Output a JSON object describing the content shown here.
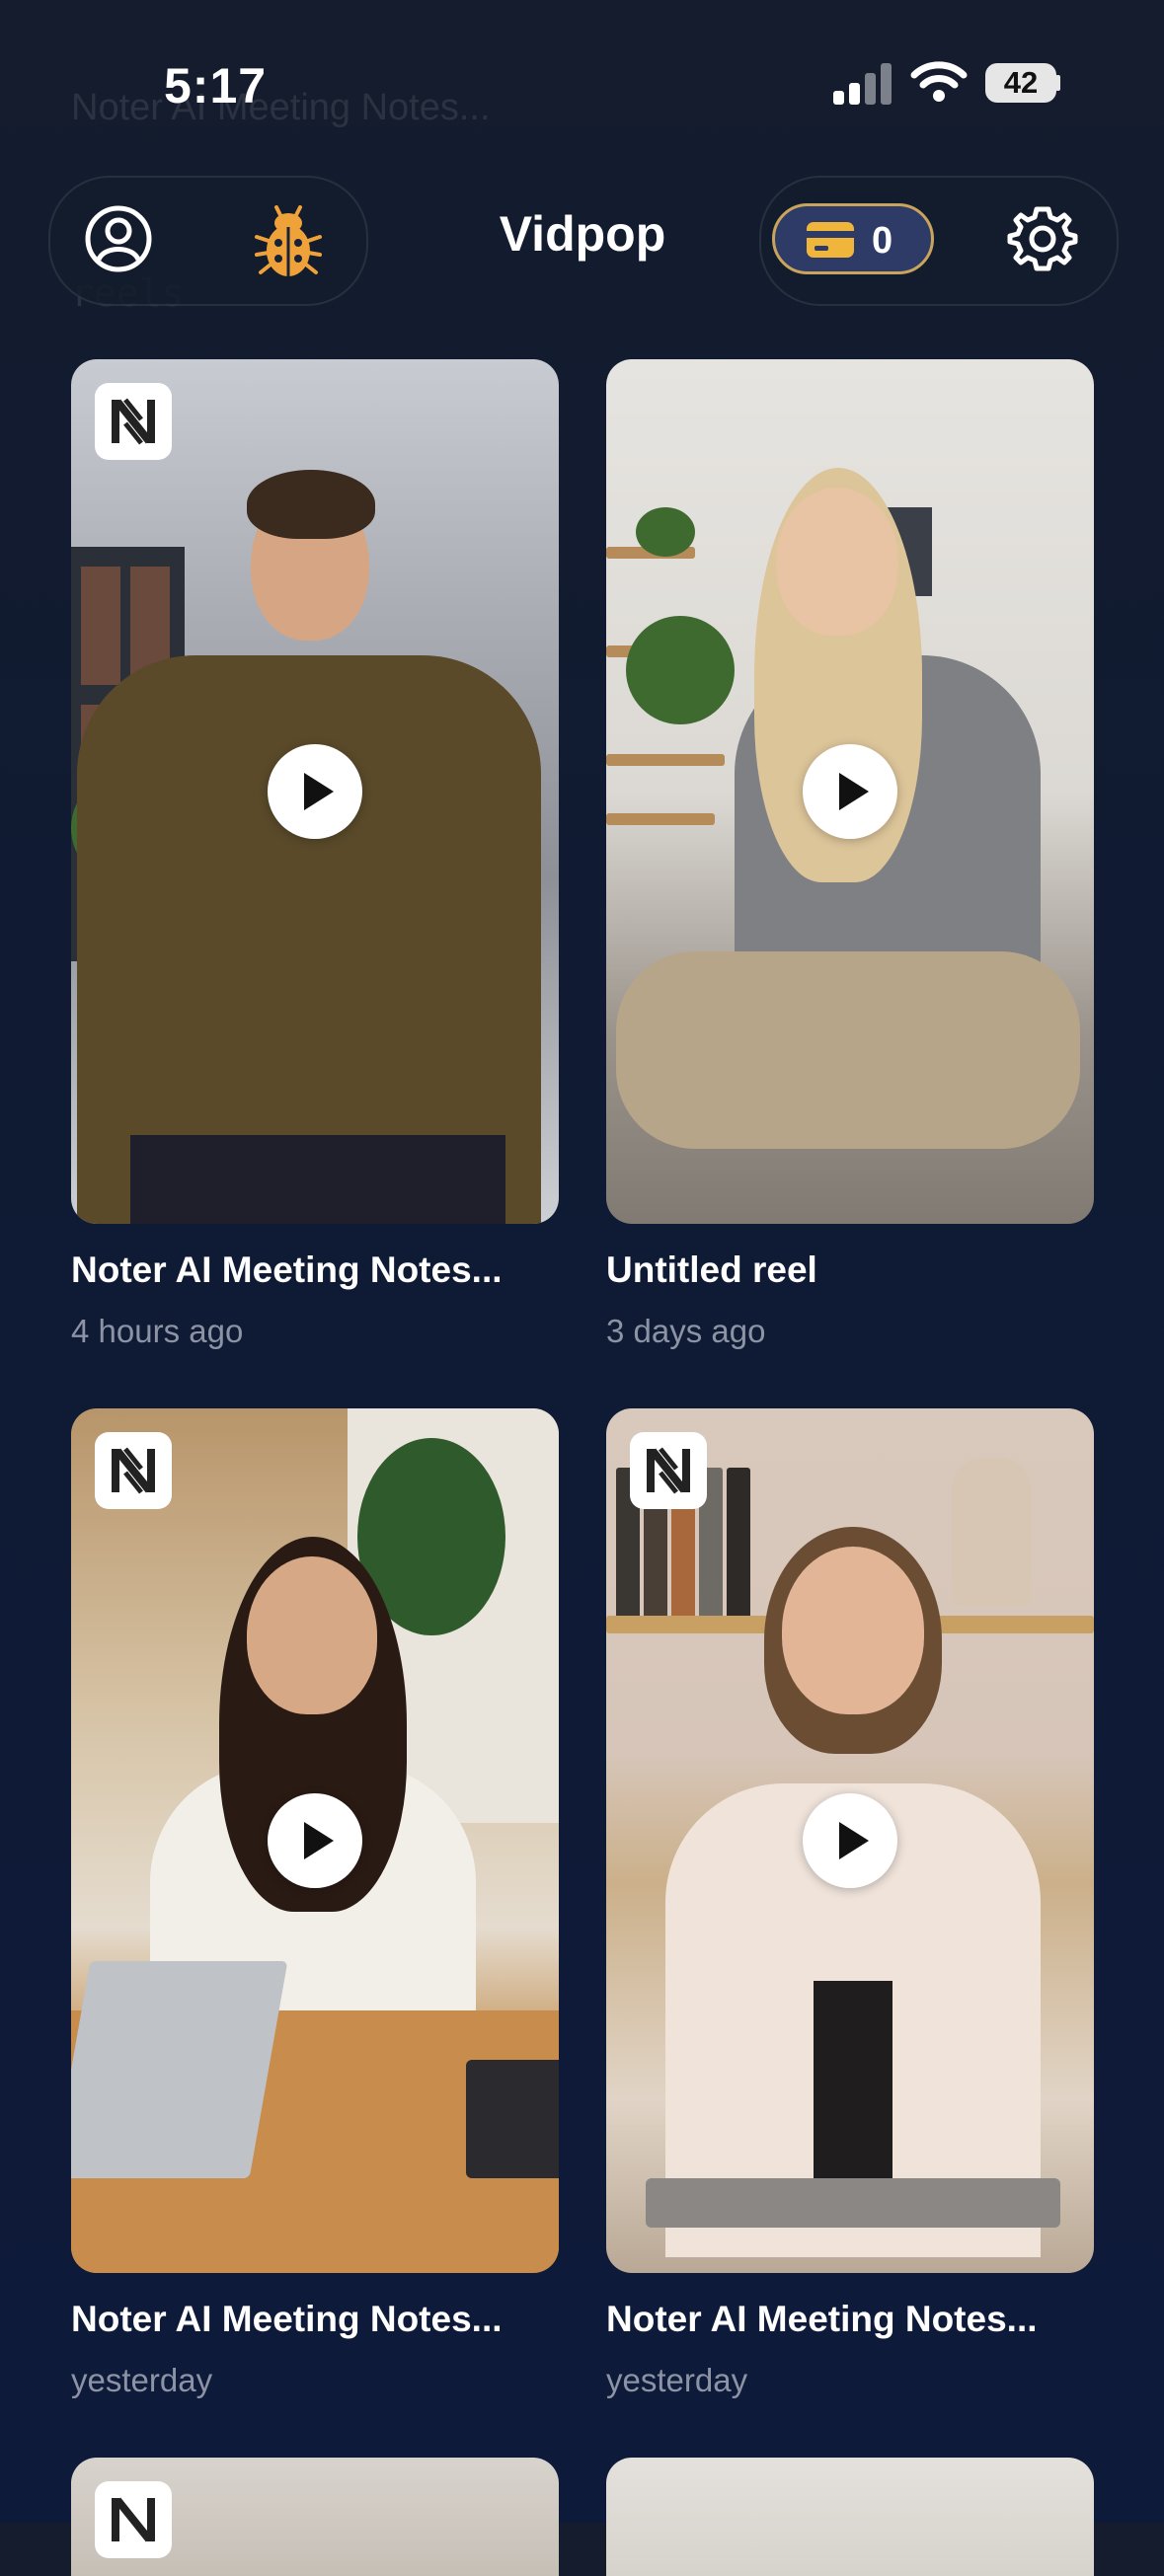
{
  "status_bar": {
    "time": "5:17",
    "battery": "42"
  },
  "background_text": {
    "line1": "Noter AI Meeting Notes...",
    "line2": "",
    "line3": "reels"
  },
  "header": {
    "app_title": "Vidpop",
    "credits": "0",
    "colors": {
      "accent_gold": "#f0b63b",
      "bug_orange": "#f0a23a",
      "pill_border": "#c9a45c"
    }
  },
  "reels": [
    {
      "title": "Noter AI Meeting Notes...",
      "time": "4 hours ago",
      "has_brand_badge": true
    },
    {
      "title": "Untitled reel",
      "time": "3 days ago",
      "has_brand_badge": false
    },
    {
      "title": "Noter AI Meeting Notes...",
      "time": "yesterday",
      "has_brand_badge": true
    },
    {
      "title": "Noter AI Meeting Notes...",
      "time": "yesterday",
      "has_brand_badge": true
    }
  ],
  "icons": {
    "profile": "profile-icon",
    "bug": "bug-icon",
    "credits": "credit-card-icon",
    "settings": "gear-icon",
    "play": "play-icon",
    "brand": "noter-logo-icon"
  }
}
